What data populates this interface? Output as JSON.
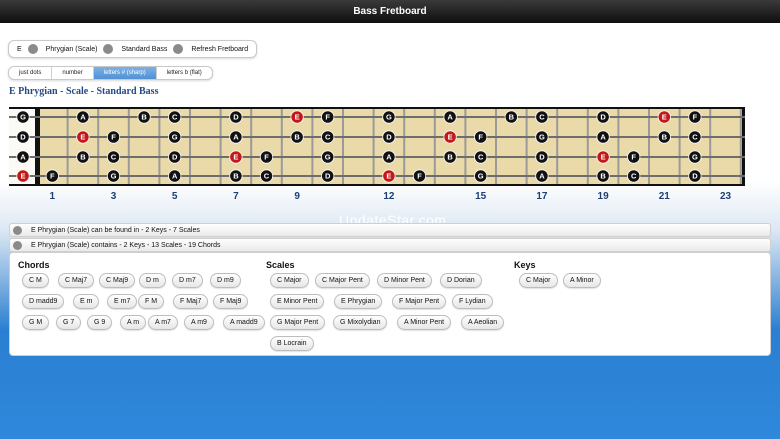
{
  "window": {
    "title": "Bass Fretboard"
  },
  "selectors": [
    {
      "label": "E"
    },
    {
      "label": "Phrygian (Scale)"
    },
    {
      "label": "Standard Bass"
    },
    {
      "label": "Refresh Fretboard"
    }
  ],
  "modes": [
    {
      "label": "just dots",
      "active": false
    },
    {
      "label": "number",
      "active": false
    },
    {
      "label": "letters # (sharp)",
      "active": true
    },
    {
      "label": "letters b (flat)",
      "active": false
    }
  ],
  "heading": "E Phrygian - Scale - Standard Bass",
  "fretboard": {
    "strings": [
      "G",
      "D",
      "A",
      "E"
    ],
    "root_color": "#c31818",
    "note_color": "#111111",
    "wood_color": "#ead9a9",
    "rows": [
      [
        {
          "fret": 2,
          "note": "A"
        },
        {
          "fret": 4,
          "note": "B"
        },
        {
          "fret": 5,
          "note": "C"
        },
        {
          "fret": 7,
          "note": "D"
        },
        {
          "fret": 9,
          "note": "E",
          "root": true
        },
        {
          "fret": 10,
          "note": "F"
        },
        {
          "fret": 12,
          "note": "G"
        },
        {
          "fret": 14,
          "note": "A"
        },
        {
          "fret": 16,
          "note": "B"
        },
        {
          "fret": 17,
          "note": "C"
        },
        {
          "fret": 19,
          "note": "D"
        },
        {
          "fret": 21,
          "note": "E",
          "root": true
        },
        {
          "fret": 22,
          "note": "F"
        }
      ],
      [
        {
          "fret": 2,
          "note": "E",
          "root": true
        },
        {
          "fret": 3,
          "note": "F"
        },
        {
          "fret": 5,
          "note": "G"
        },
        {
          "fret": 7,
          "note": "A"
        },
        {
          "fret": 9,
          "note": "B"
        },
        {
          "fret": 10,
          "note": "C"
        },
        {
          "fret": 12,
          "note": "D"
        },
        {
          "fret": 14,
          "note": "E",
          "root": true
        },
        {
          "fret": 15,
          "note": "F"
        },
        {
          "fret": 17,
          "note": "G"
        },
        {
          "fret": 19,
          "note": "A"
        },
        {
          "fret": 21,
          "note": "B"
        },
        {
          "fret": 22,
          "note": "C"
        }
      ],
      [
        {
          "fret": 2,
          "note": "B"
        },
        {
          "fret": 3,
          "note": "C"
        },
        {
          "fret": 5,
          "note": "D"
        },
        {
          "fret": 7,
          "note": "E",
          "root": true
        },
        {
          "fret": 8,
          "note": "F"
        },
        {
          "fret": 10,
          "note": "G"
        },
        {
          "fret": 12,
          "note": "A"
        },
        {
          "fret": 14,
          "note": "B"
        },
        {
          "fret": 15,
          "note": "C"
        },
        {
          "fret": 17,
          "note": "D"
        },
        {
          "fret": 19,
          "note": "E",
          "root": true
        },
        {
          "fret": 20,
          "note": "F"
        },
        {
          "fret": 22,
          "note": "G"
        }
      ],
      [
        {
          "fret": 1,
          "note": "F"
        },
        {
          "fret": 3,
          "note": "G"
        },
        {
          "fret": 5,
          "note": "A"
        },
        {
          "fret": 7,
          "note": "B"
        },
        {
          "fret": 8,
          "note": "C"
        },
        {
          "fret": 10,
          "note": "D"
        },
        {
          "fret": 12,
          "note": "E",
          "root": true
        },
        {
          "fret": 13,
          "note": "F"
        },
        {
          "fret": 15,
          "note": "G"
        },
        {
          "fret": 17,
          "note": "A"
        },
        {
          "fret": 19,
          "note": "B"
        },
        {
          "fret": 20,
          "note": "C"
        },
        {
          "fret": 22,
          "note": "D"
        }
      ]
    ],
    "fret_numbers": [
      "1",
      "3",
      "5",
      "7",
      "9",
      "12",
      "15",
      "17",
      "19",
      "21",
      "23"
    ]
  },
  "watermark": "UpdateStar.com",
  "info": {
    "found_in": "E Phrygian (Scale) can be found in - 2 Keys - 7 Scales",
    "contains": "E Phrygian (Scale) contains - 2 Keys - 13 Scales - 19 Chords"
  },
  "chords": {
    "title": "Chords",
    "items": [
      "C M",
      "C Maj7",
      "C Maj9",
      "D m",
      "D m7",
      "D m9",
      "D madd9",
      "E m",
      "E m7",
      "F M",
      "F Maj7",
      "F Maj9",
      "G M",
      "G 7",
      "G 9",
      "A m",
      "A m7",
      "A m9",
      "A madd9"
    ]
  },
  "scales": {
    "title": "Scales",
    "items": [
      "C Major",
      "C Major Pent",
      "D Minor Pent",
      "D Dorian",
      "E Minor Pent",
      "E Phrygian",
      "F Major Pent",
      "F Lydian",
      "G Major Pent",
      "G Mixolydian",
      "A Minor Pent",
      "A Aeolian",
      "B Locrain"
    ]
  },
  "keys": {
    "title": "Keys",
    "items": [
      "C Major",
      "A Minor"
    ]
  }
}
